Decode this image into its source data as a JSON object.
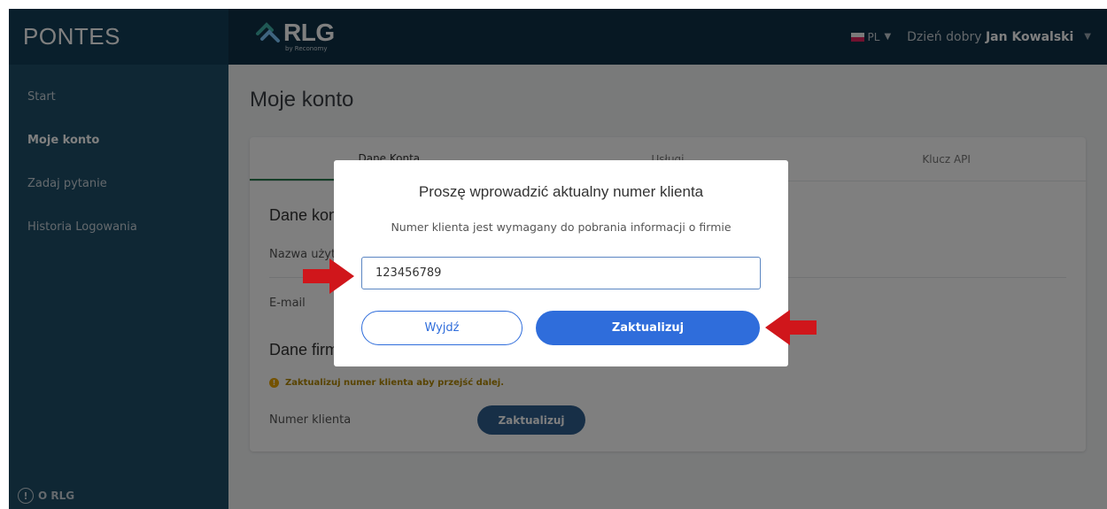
{
  "app": {
    "brand": "PONTES",
    "logo_text": "RLG",
    "logo_subtext": "by Reconomy",
    "language": "PL",
    "greeting": "Dzień dobry",
    "user_name": "Jan Kowalski"
  },
  "sidebar": {
    "items": [
      {
        "label": "Start"
      },
      {
        "label": "Moje konto"
      },
      {
        "label": "Zadaj pytanie"
      },
      {
        "label": "Historia Logowania"
      }
    ],
    "footer_label": "O RLG"
  },
  "main": {
    "page_title": "Moje konto",
    "tabs": [
      {
        "label": "Dane Konta"
      },
      {
        "label": "Usługi"
      },
      {
        "label": "Klucz API"
      }
    ],
    "account_section_title": "Dane konta",
    "username_label": "Nazwa użytkownika",
    "email_label": "E-mail",
    "company_section_title": "Dane firmy",
    "warning_text": "Zaktualizuj numer klienta aby przejść dalej.",
    "client_number_label": "Numer klienta",
    "update_button": "Zaktualizuj"
  },
  "modal": {
    "title": "Proszę wprowadzić aktualny numer klienta",
    "subtitle": "Numer klienta jest wymagany do pobrania informacji o firmie",
    "input_value": "123456789",
    "exit_button": "Wyjdź",
    "update_button": "Zaktualizuj"
  },
  "colors": {
    "topbar": "#0f3146",
    "sidebar": "#1f4f68",
    "accent": "#2f6ddb",
    "annotation_arrow": "#d0161b"
  }
}
